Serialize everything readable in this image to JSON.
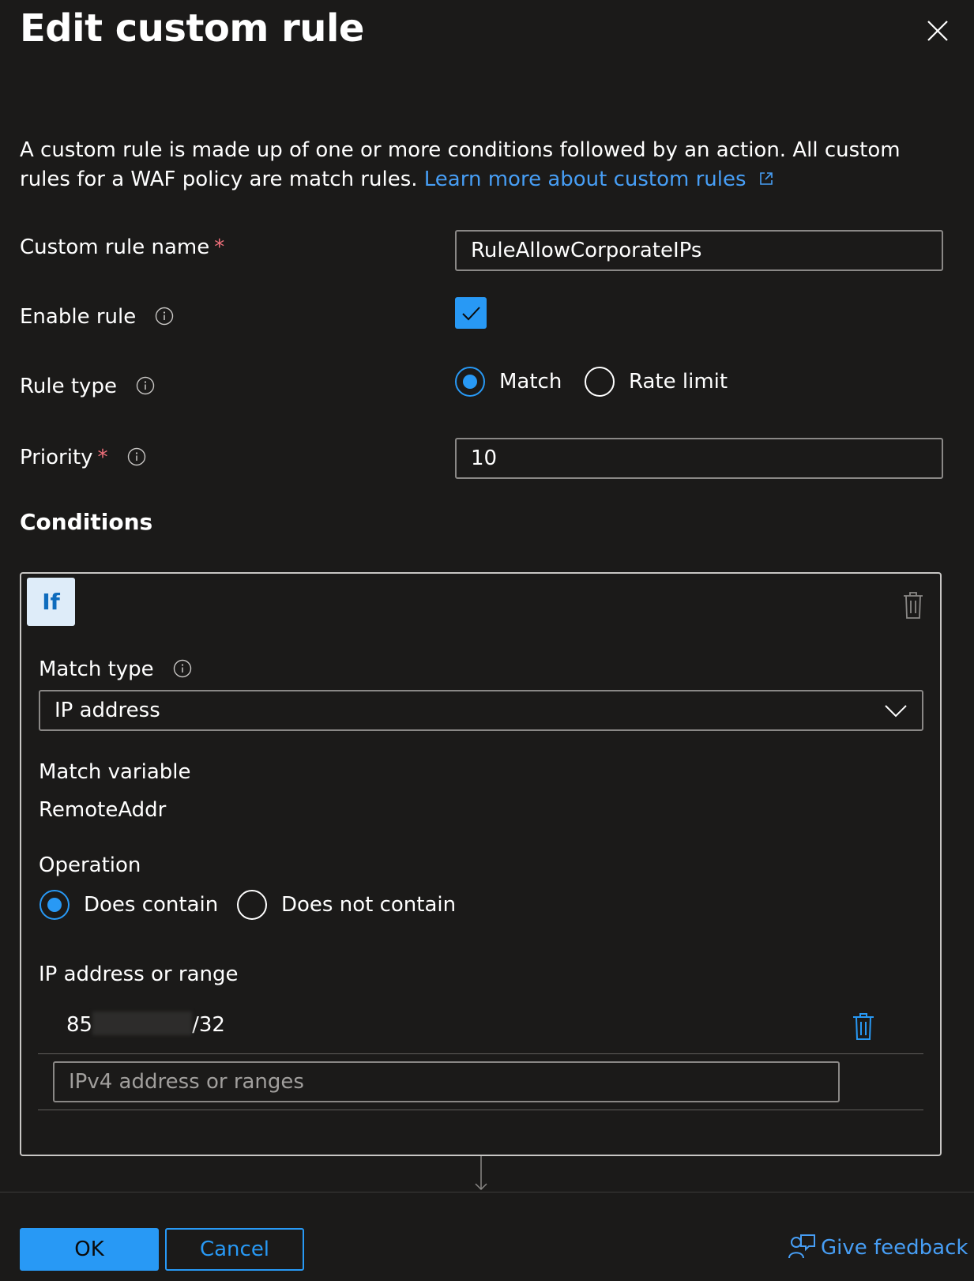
{
  "panel": {
    "title": "Edit custom rule"
  },
  "description": {
    "text": "A custom rule is made up of one or more conditions followed by an action. All custom rules for a WAF policy are match rules.",
    "link": "Learn more about custom rules"
  },
  "fields": {
    "rule_name_label": "Custom rule name",
    "rule_name_value": "RuleAllowCorporateIPs",
    "enable_label": "Enable rule",
    "enable_checked": true,
    "rule_type_label": "Rule type",
    "rule_type_options": [
      "Match",
      "Rate limit"
    ],
    "rule_type_selected": "Match",
    "priority_label": "Priority",
    "priority_value": "10",
    "required_marker": "*"
  },
  "conditions": {
    "heading": "Conditions",
    "badge": "If",
    "match_type_label": "Match type",
    "match_type_value": "IP address",
    "match_variable_label": "Match variable",
    "match_variable_value": "RemoteAddr",
    "operation_label": "Operation",
    "operation_options": [
      "Does contain",
      "Does not contain"
    ],
    "operation_selected": "Does contain",
    "ip_label": "IP address or range",
    "ip_entries": [
      {
        "prefix": "85",
        "suffix": "/32"
      }
    ],
    "ip_placeholder": "IPv4 address or ranges"
  },
  "footer": {
    "ok": "OK",
    "cancel": "Cancel",
    "feedback": "Give feedback"
  },
  "colors": {
    "accent": "#2899f5",
    "link": "#479ef5",
    "required": "#f1707b",
    "background": "#1b1a19"
  }
}
